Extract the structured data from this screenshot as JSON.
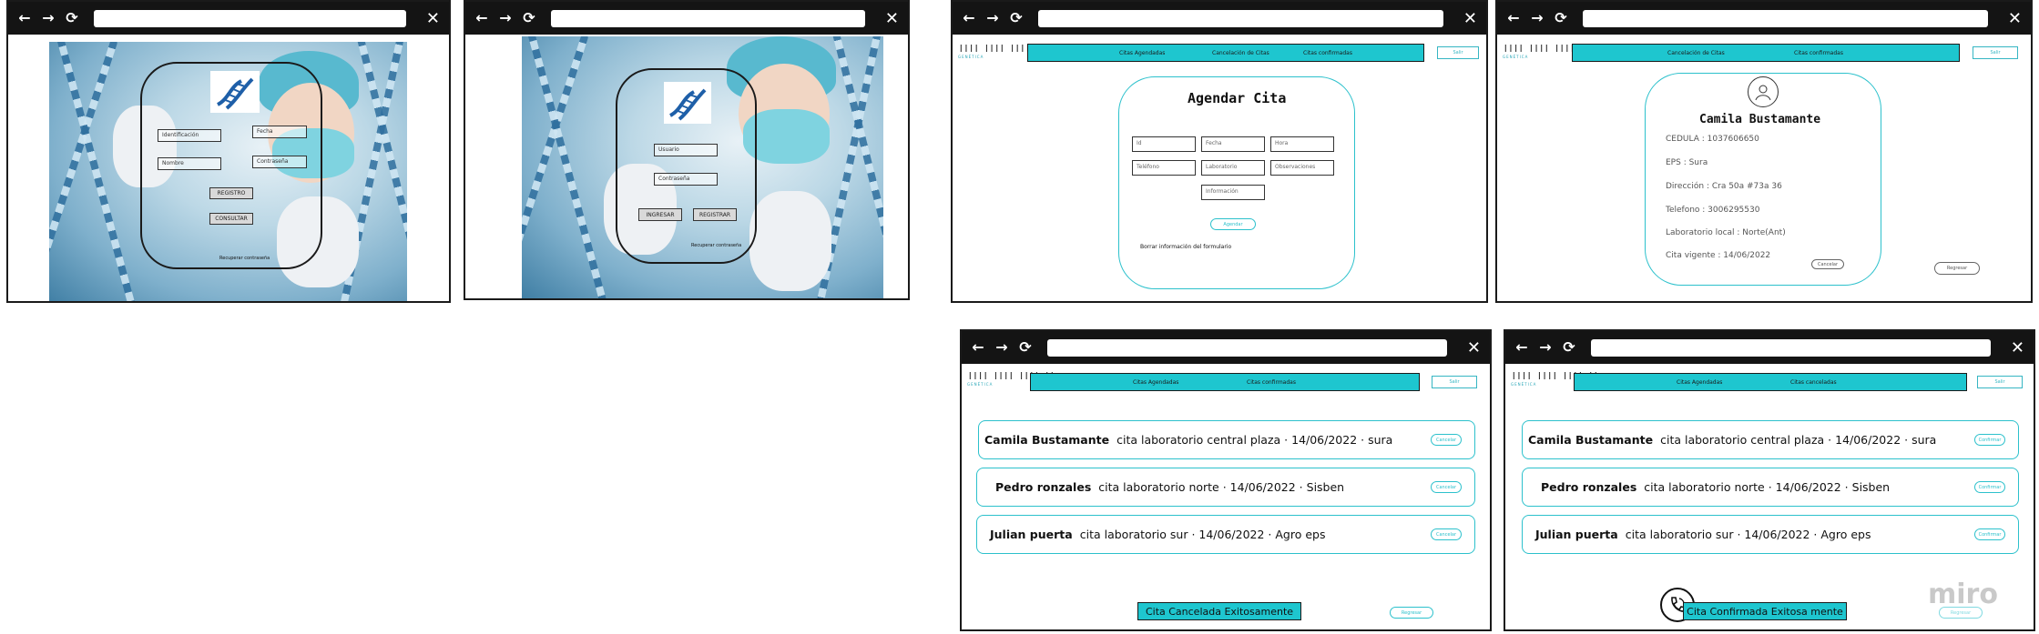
{
  "browser": {
    "back": "←",
    "forward": "→",
    "reload": "⟳",
    "close": "✕"
  },
  "win1": {
    "fields": [
      "Identificación",
      "Fecha",
      "Nombre",
      "Contraseña"
    ],
    "buttons": [
      "REGISTRO",
      "CONSULTAR"
    ],
    "link": "Recuperar contraseña"
  },
  "win2": {
    "fields": [
      "Usuario",
      "Contraseña"
    ],
    "buttons": [
      "INGRESAR",
      "REGISTRAR"
    ],
    "link": "Recuperar contraseña"
  },
  "win3": {
    "nav": [
      "Citas Agendadas",
      "Cancelación de Citas",
      "Citas confirmadas"
    ],
    "exit": "Salir",
    "title": "Agendar Cita",
    "fields": [
      "Id",
      "Fecha",
      "Hora",
      "Teléfono",
      "Laboratorio",
      "Observaciones",
      "Información"
    ],
    "submit": "Agendar",
    "note": "Borrar información del formulario"
  },
  "win4": {
    "nav": [
      "Cancelación de Citas",
      "Citas confirmadas"
    ],
    "exit": "Salir",
    "name": "Camila Bustamante",
    "details": [
      "CEDULA : 1037606650",
      "EPS : Sura",
      "Dirección : Cra 50a #73a 36",
      "Telefono : 3006295530",
      "Laboratorio local : Norte(Ant)",
      "Cita vigente : 14/06/2022"
    ],
    "small_button": "Cancelar",
    "back": "Regresar"
  },
  "win5": {
    "nav": [
      "Citas Agendadas",
      "Citas confirmadas"
    ],
    "exit": "Salir",
    "rows": [
      {
        "name": "Camila Bustamante",
        "text": "cita laboratorio central plaza ·  14/06/2022 ·  sura",
        "action": "Cancelar"
      },
      {
        "name": "Pedro ronzales",
        "text": "cita laboratorio norte ·  14/06/2022 ·  Sisben",
        "action": "Cancelar"
      },
      {
        "name": "Julian puerta",
        "text": "cita laboratorio sur · 14/06/2022 ·   Agro eps",
        "action": "Cancelar"
      }
    ],
    "toast": "Cita Cancelada Exitosamente",
    "back": "Regresar"
  },
  "win6": {
    "nav": [
      "Citas Agendadas",
      "Citas canceladas"
    ],
    "exit": "Salir",
    "rows": [
      {
        "name": "Camila Bustamante",
        "text": "cita laboratorio central plaza ·  14/06/2022 ·  sura",
        "action": "Confirmar"
      },
      {
        "name": "Pedro ronzales",
        "text": "cita laboratorio norte ·  14/06/2022 ·  Sisben",
        "action": "Confirmar"
      },
      {
        "name": "Julian puerta",
        "text": "cita laboratorio sur · 14/06/2022 ·   Agro eps",
        "action": "Confirmar"
      }
    ],
    "toast": "Cita Confirmada Exitosa mente",
    "back": "Regresar",
    "watermark": "miro"
  },
  "brand": {
    "bars": "ǀǀǀǀ ǀǀǀǀ ǀǀǀǀ ǀǀ",
    "sub": "GENÉTICA"
  },
  "colors": {
    "accent": "#1ec6cf",
    "outline": "#2cc1cc",
    "chrome": "#141414"
  }
}
